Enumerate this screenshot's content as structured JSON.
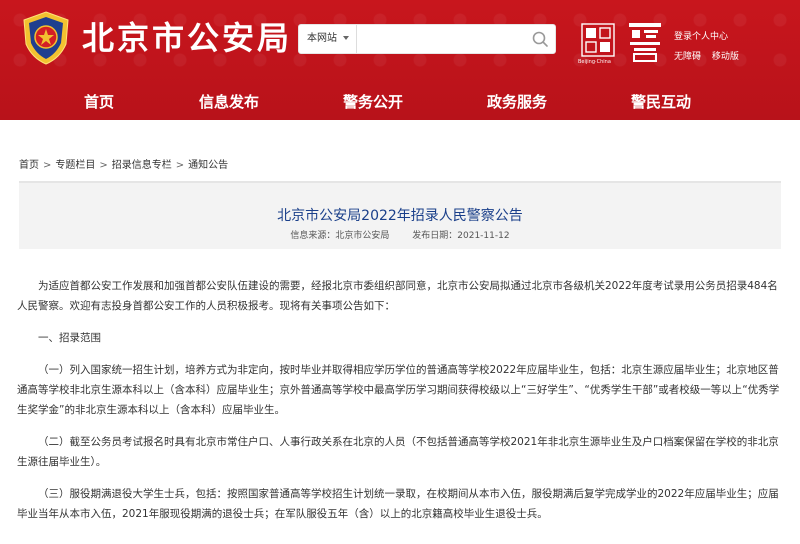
{
  "header": {
    "site_title": "北京市公安局",
    "search": {
      "scope": "本网站",
      "placeholder": ""
    },
    "logo_text": "Beijing·China",
    "top_links": {
      "login": "登录个人中心",
      "accessible": "无障碍",
      "mobile": "移动版"
    },
    "colors": {
      "brand_red": "#c8161d",
      "title_blue": "#1a3f8a"
    }
  },
  "nav": {
    "items": [
      "首页",
      "信息发布",
      "警务公开",
      "政务服务",
      "警民互动"
    ]
  },
  "breadcrumb": [
    "首页",
    "专题栏目",
    "招录信息专栏",
    "通知公告"
  ],
  "article": {
    "title": "北京市公安局2022年招录人民警察公告",
    "source": "信息来源：北京市公安局",
    "date": "发布日期：2021-11-12",
    "paragraphs": [
      "为适应首都公安工作发展和加强首都公安队伍建设的需要，经报北京市委组织部同意，北京市公安局拟通过北京市各级机关2022年度考试录用公务员招录484名人民警察。欢迎有志投身首都公安工作的人员积极报考。现将有关事项公告如下：",
      "一、招录范围",
      "（一）列入国家统一招生计划，培养方式为非定向，按时毕业并取得相应学历学位的普通高等学校2022年应届毕业生，包括：北京生源应届毕业生；北京地区普通高等学校非北京生源本科以上（含本科）应届毕业生；京外普通高等学校中最高学历学习期间获得校级以上“三好学生”、“优秀学生干部”或者校级一等以上“优秀学生奖学金”的非北京生源本科以上（含本科）应届毕业生。",
      "（二）截至公务员考试报名时具有北京市常住户口、人事行政关系在北京的人员（不包括普通高等学校2021年非北京生源毕业生及户口档案保留在学校的非北京生源往届毕业生）。",
      "（三）服役期满退役大学生士兵，包括：按照国家普通高等学校招生计划统一录取，在校期间从本市入伍，服役期满后复学完成学业的2022年应届毕业生；应届毕业当年从本市入伍，2021年服现役期满的退役士兵；在军队服役五年（含）以上的北京籍高校毕业生退役士兵。"
    ]
  }
}
